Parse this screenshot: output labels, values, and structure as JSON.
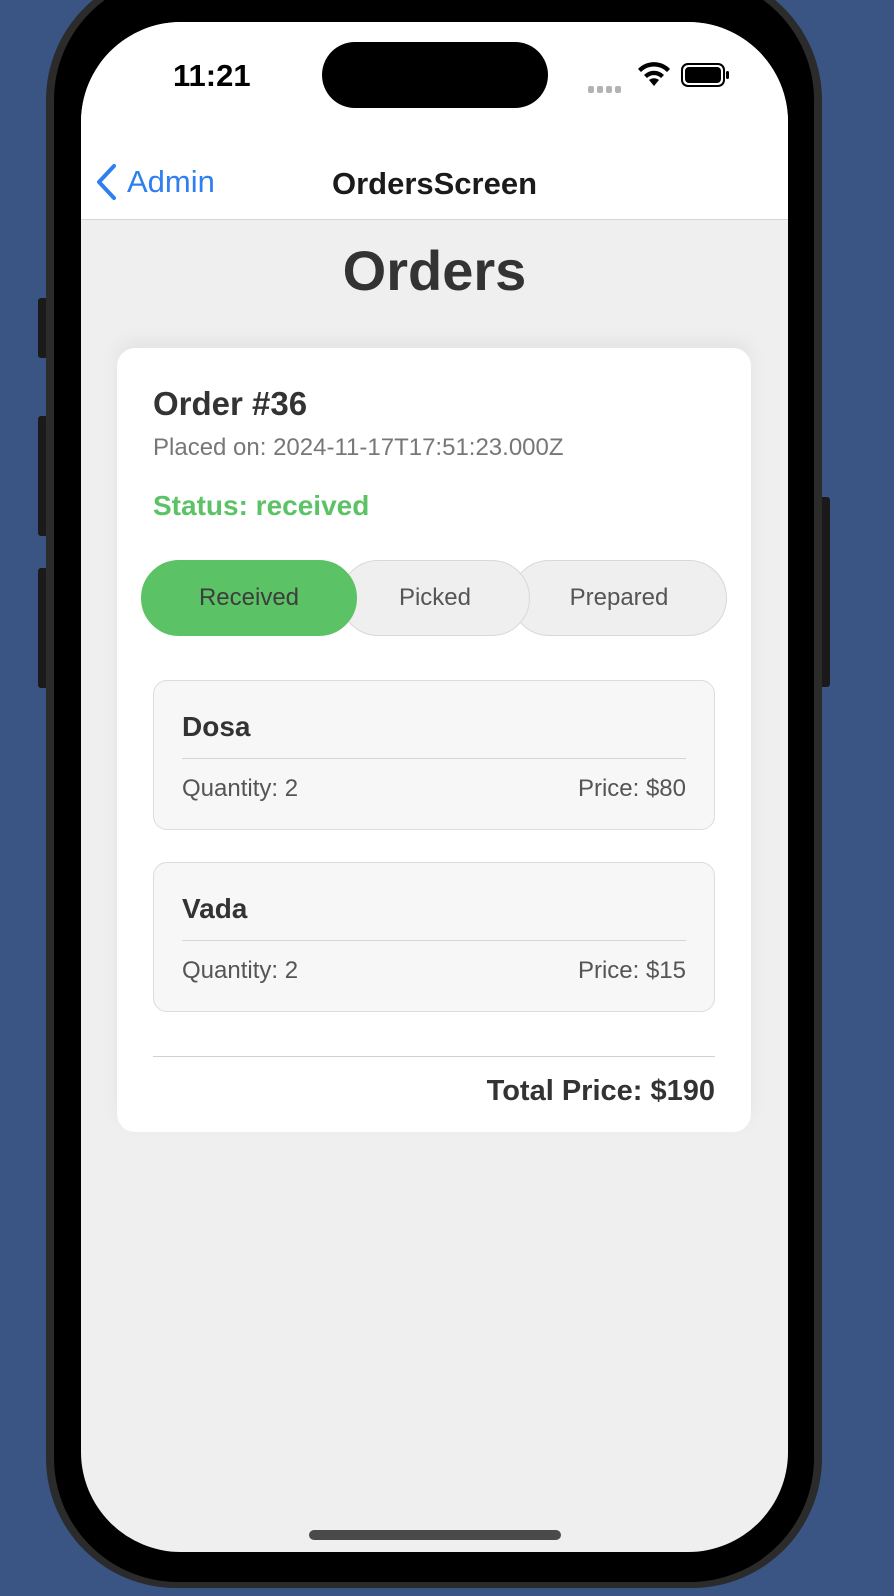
{
  "status_bar": {
    "time": "11:21",
    "icons": [
      "cellular-signal-icon",
      "wifi-icon",
      "battery-icon"
    ]
  },
  "navbar": {
    "back_label": "Admin",
    "title": "OrdersScreen"
  },
  "page": {
    "title": "Orders"
  },
  "order": {
    "title": "Order #36",
    "placed_on": "Placed on: 2024-11-17T17:51:23.000Z",
    "status": "Status: received",
    "status_buttons": [
      {
        "label": "Received",
        "selected": true
      },
      {
        "label": "Picked",
        "selected": false
      },
      {
        "label": "Prepared",
        "selected": false
      }
    ],
    "items": [
      {
        "name": "Dosa",
        "quantity": "Quantity: 2",
        "price": "Price: $80"
      },
      {
        "name": "Vada",
        "quantity": "Quantity: 2",
        "price": "Price: $15"
      }
    ],
    "total": "Total Price: $190"
  },
  "colors": {
    "accent_blue": "#2f7ff0",
    "status_green": "#5cc266",
    "background": "#3a5584"
  }
}
